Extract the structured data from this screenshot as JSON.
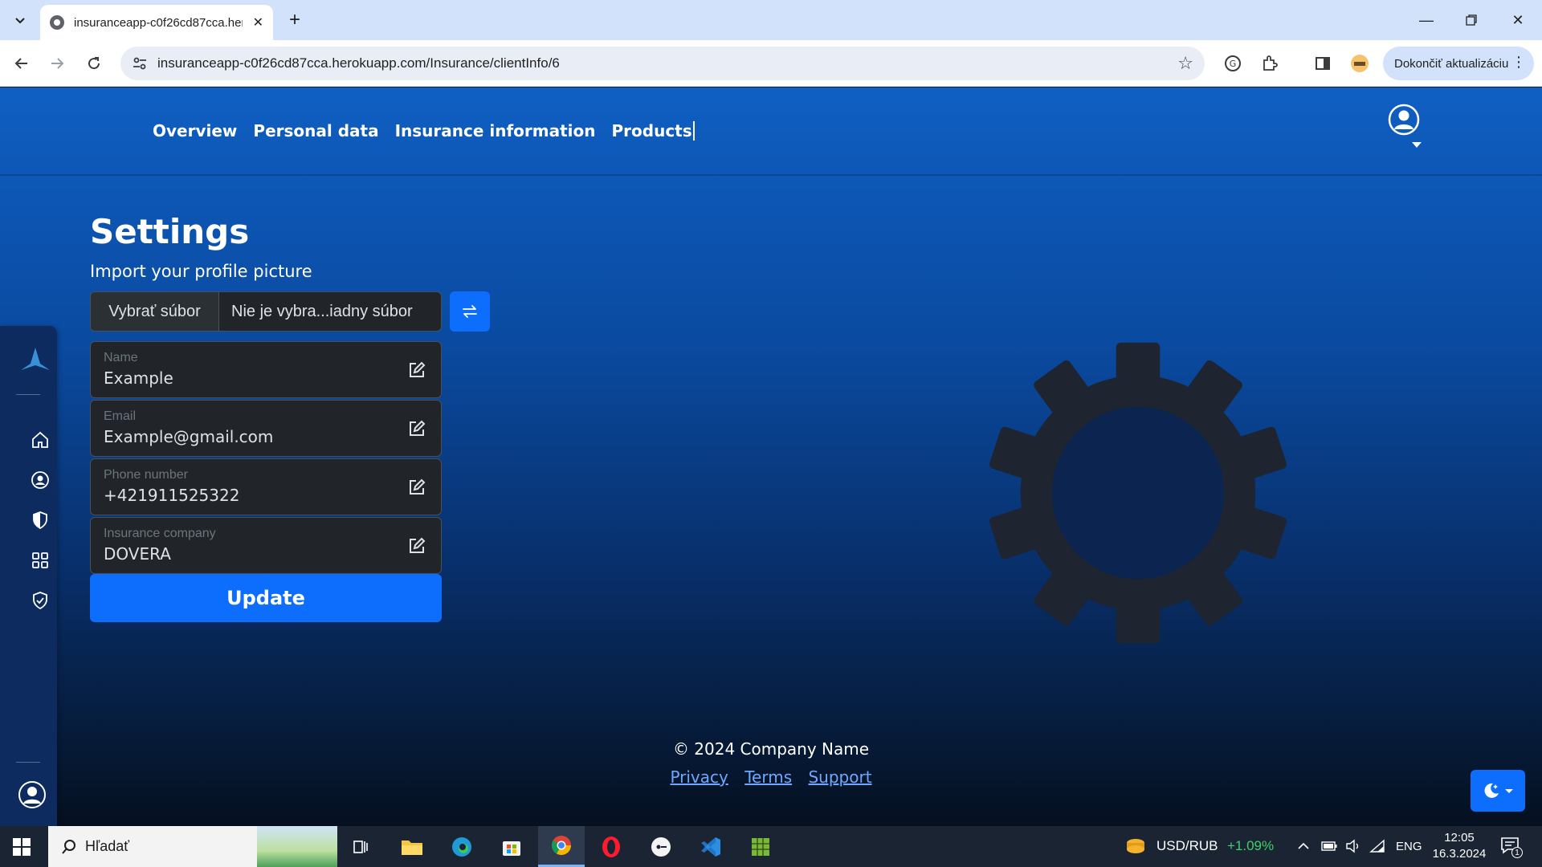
{
  "browser": {
    "tab_title": "insuranceapp-c0f26cd87cca.her",
    "url": "insuranceapp-c0f26cd87cca.herokuapp.com/Insurance/clientInfo/6",
    "update_button": "Dokončiť aktualizáciu"
  },
  "nav": {
    "items": [
      {
        "label": "Overview"
      },
      {
        "label": "Personal data"
      },
      {
        "label": "Insurance information"
      },
      {
        "label": "Products"
      }
    ]
  },
  "settings": {
    "title": "Settings",
    "import_label": "Import your profile picture",
    "file_button": "Vybrať súbor",
    "file_name": "Nie je vybra...iadny súbor",
    "fields": [
      {
        "label": "Name",
        "value": "Example"
      },
      {
        "label": "Email",
        "value": "Example@gmail.com"
      },
      {
        "label": "Phone number",
        "value": "+421911525322"
      },
      {
        "label": "Insurance company",
        "value": "DOVERA"
      }
    ],
    "submit": "Update"
  },
  "footer": {
    "copyright": "© 2024 Company Name",
    "links": [
      "Privacy",
      "Terms",
      "Support"
    ]
  },
  "taskbar": {
    "search_placeholder": "Hľadať",
    "ticker": "USD/RUB",
    "ticker_change": "+1.09%",
    "lang": "ENG",
    "time": "12:05",
    "date": "16.3.2024",
    "notifications": "1"
  },
  "colors": {
    "primary": "#0d6efd",
    "header_blue": "#0f5fc2",
    "field_bg": "#212529",
    "gear": "#1e2430",
    "link": "#6ea8fe"
  }
}
